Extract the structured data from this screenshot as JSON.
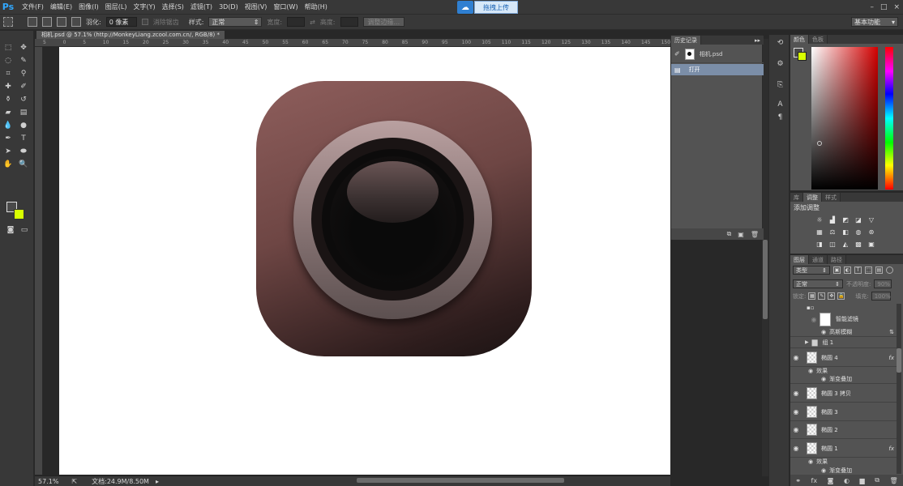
{
  "menubar": {
    "logo": "Ps",
    "items": [
      "文件(F)",
      "编辑(E)",
      "图像(I)",
      "图层(L)",
      "文字(Y)",
      "选择(S)",
      "滤镜(T)",
      "3D(D)",
      "视图(V)",
      "窗口(W)",
      "帮助(H)"
    ],
    "upload_label": "拖拽上传",
    "window_controls": [
      "–",
      "□",
      "×"
    ]
  },
  "options": {
    "feather_label": "羽化:",
    "feather_value": "0 像素",
    "antialias_label": "消除锯齿",
    "style_label": "样式:",
    "style_value": "正常",
    "width_label": "宽度:",
    "height_label": "高度:",
    "refine_button": "调整边缘...",
    "workspace": "基本功能"
  },
  "document": {
    "tab_title": "相机.psd @ 57.1% (http://MonkeyLiang.zcool.com.cn/, RGB/8) *",
    "ruler_ticks": [
      "5",
      "0",
      "5",
      "10",
      "15",
      "20",
      "25",
      "30",
      "35",
      "40",
      "45",
      "50",
      "55",
      "60",
      "65",
      "70",
      "75",
      "80",
      "85",
      "90",
      "95",
      "100",
      "105",
      "110",
      "115",
      "120",
      "125",
      "130",
      "135",
      "140",
      "145",
      "150"
    ]
  },
  "status": {
    "zoom": "57.1%",
    "doc_info": "文档:24.9M/8.50M"
  },
  "history": {
    "tabs": [
      "历史记录"
    ],
    "snapshot_name": "相机.psd",
    "entries": [
      "打开"
    ]
  },
  "color_panel": {
    "tabs": [
      "颜色",
      "色板"
    ],
    "foreground": "#4a4a4a",
    "background": "#d8ff00"
  },
  "adjustments": {
    "tabs": [
      "库",
      "调整",
      "样式"
    ],
    "title": "添加调整"
  },
  "layers": {
    "tabs": [
      "图层",
      "通道",
      "路径"
    ],
    "filter_kind": "类型",
    "blend_mode": "正常",
    "opacity_label": "不透明度:",
    "opacity_value": "90%",
    "lock_label": "锁定:",
    "fill_label": "填充:",
    "fill_value": "100%",
    "smart_filter": "智能滤镜",
    "smart_filter_item": "高斯模糊",
    "items": [
      {
        "name": "组 1",
        "type": "group"
      },
      {
        "name": "椭圆 4",
        "fx": true,
        "effects": [
          "效果",
          "渐变叠加"
        ]
      },
      {
        "name": "椭圆 3 拷贝"
      },
      {
        "name": "椭圆 3"
      },
      {
        "name": "椭圆 2"
      },
      {
        "name": "椭圆 1",
        "fx": true,
        "effects": [
          "效果",
          "渐变叠加"
        ]
      }
    ]
  }
}
